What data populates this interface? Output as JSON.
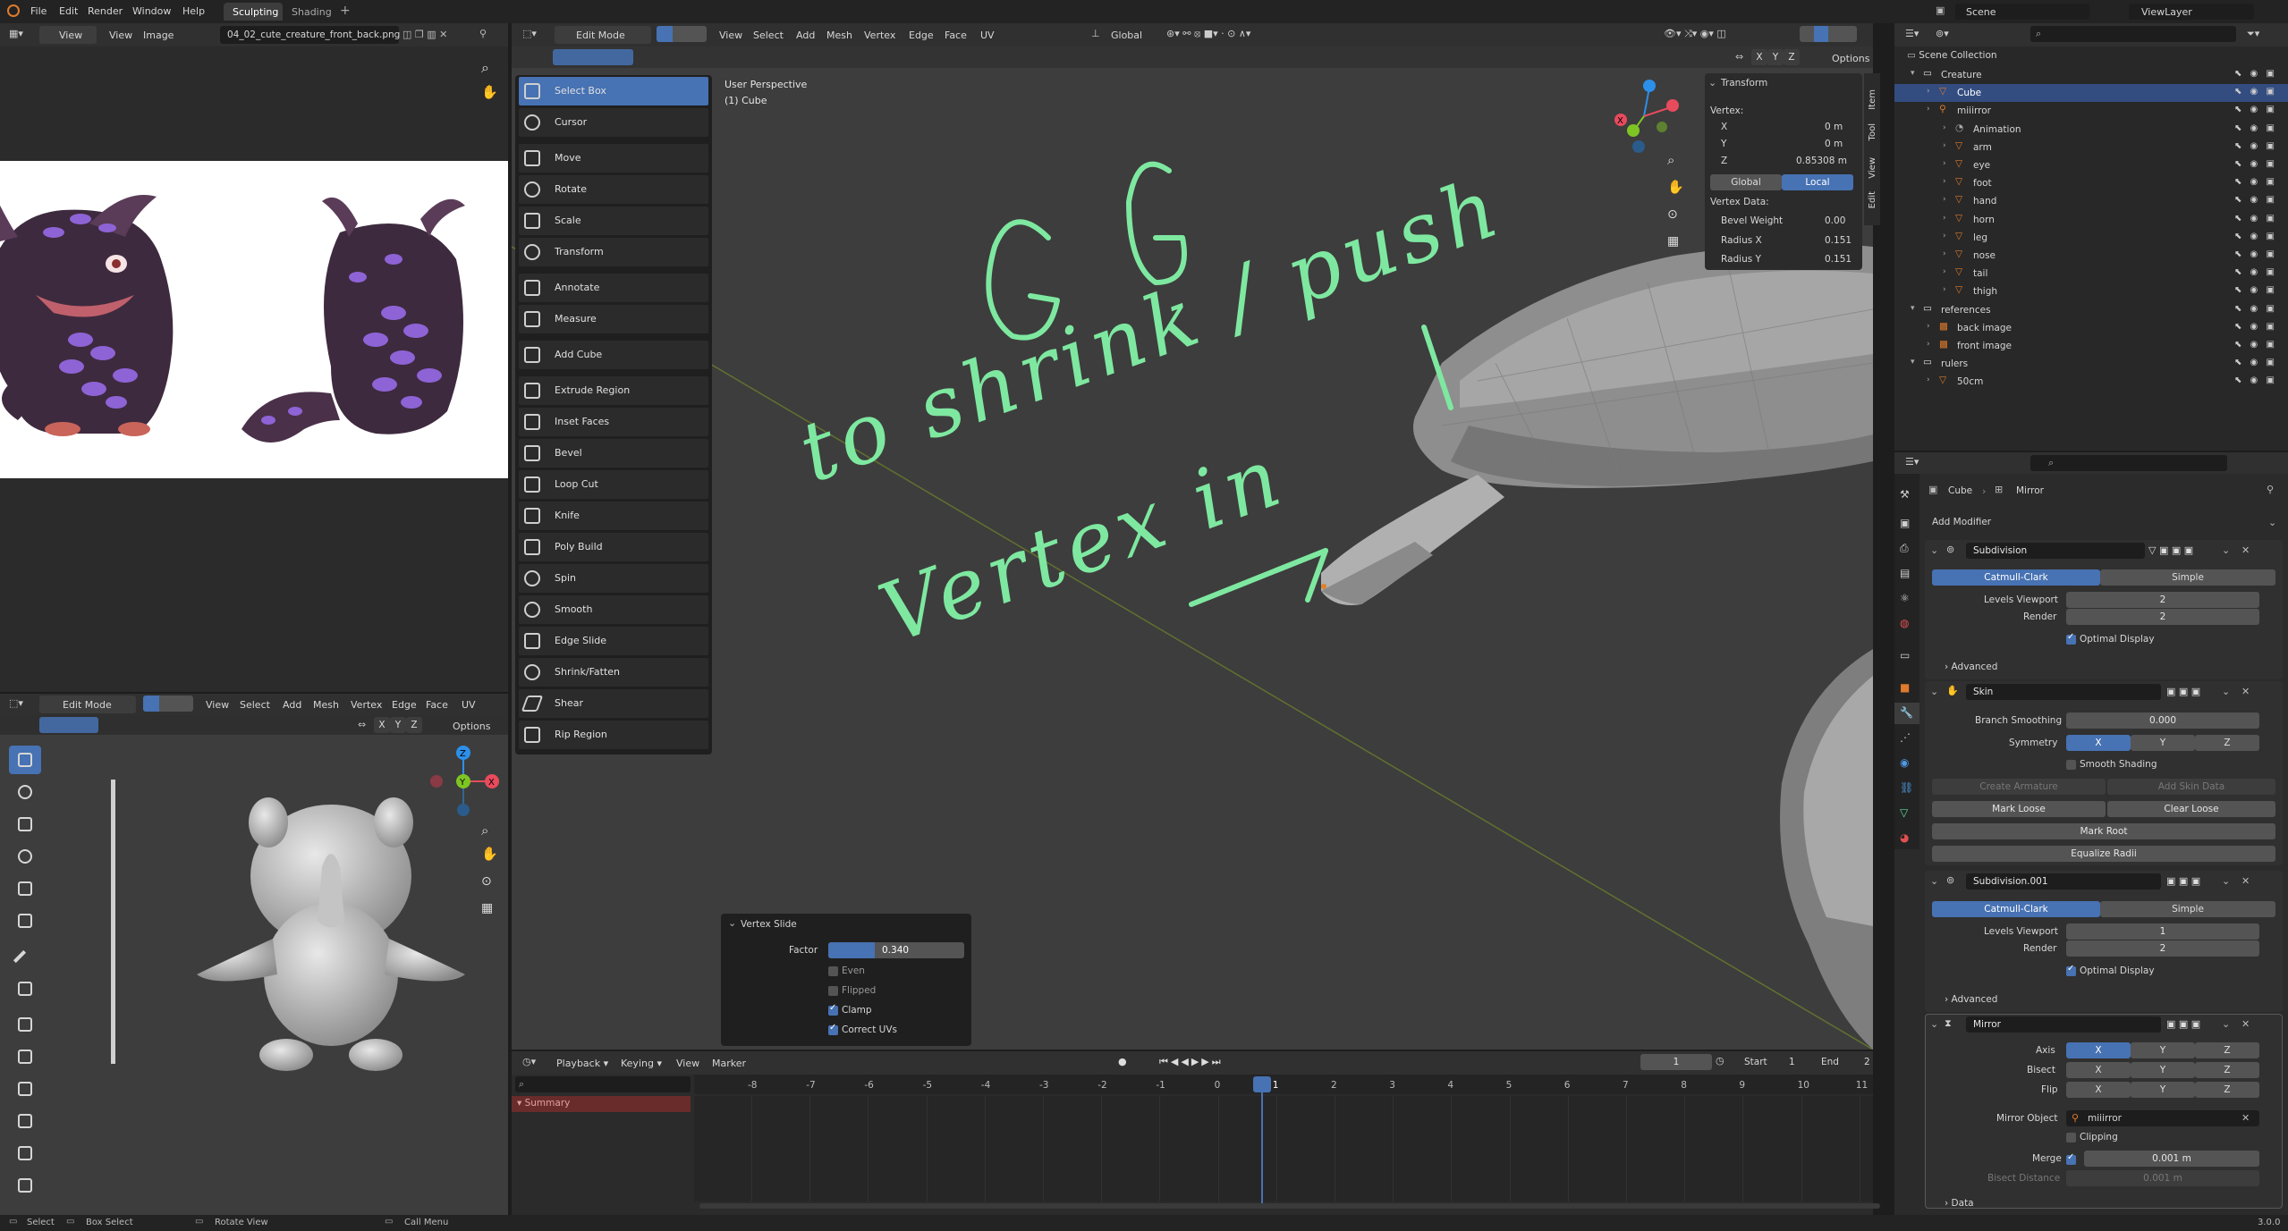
{
  "menubar": {
    "items": [
      "File",
      "Edit",
      "Render",
      "Window",
      "Help"
    ],
    "workspaces": [
      "Sculpting",
      "Shading"
    ],
    "add_tab": "+",
    "scene": "Scene",
    "view_layer": "ViewLayer"
  },
  "image_editor": {
    "view": "View",
    "menu": [
      "View",
      "Image"
    ],
    "filename": "04_02_cute_creature_front_back.png"
  },
  "viewport": {
    "mode": "Edit Mode",
    "menu": [
      "View",
      "Select",
      "Add",
      "Mesh",
      "Vertex",
      "Edge",
      "Face",
      "UV"
    ],
    "orientation": "Global",
    "options": "Options",
    "xyz": [
      "X",
      "Y",
      "Z"
    ],
    "perspective": "User Perspective",
    "object": "(1) Cube",
    "tools": [
      "Select Box",
      "Cursor",
      "Move",
      "Rotate",
      "Scale",
      "Transform",
      "Annotate",
      "Measure",
      "Add Cube",
      "Extrude Region",
      "Inset Faces",
      "Bevel",
      "Loop Cut",
      "Knife",
      "Poly Build",
      "Spin",
      "Smooth",
      "Edge Slide",
      "Shrink/Fatten",
      "Shear",
      "Rip Region"
    ],
    "side_tabs": [
      "Item",
      "Tool",
      "View",
      "Edit"
    ],
    "annotation": {
      "line1": "GG",
      "line2": "to shrink / push",
      "line3": "Vertex in"
    }
  },
  "transform_panel": {
    "title": "Transform",
    "vertex_label": "Vertex:",
    "x_label": "X",
    "x_value": "0 m",
    "y_label": "Y",
    "y_value": "0 m",
    "z_label": "Z",
    "z_value": "0.85308 m",
    "global": "Global",
    "local": "Local",
    "vertex_data": "Vertex Data:",
    "bevel_weight_label": "Bevel Weight",
    "bevel_weight": "0.00",
    "radius_x_label": "Radius X",
    "radius_x": "0.151",
    "radius_y_label": "Radius Y",
    "radius_y": "0.151"
  },
  "vertex_slide": {
    "title": "Vertex Slide",
    "factor_label": "Factor",
    "factor": "0.340",
    "factor_fraction": 0.34,
    "even": "Even",
    "flipped": "Flipped",
    "clamp": "Clamp",
    "correct_uvs": "Correct UVs"
  },
  "small_viewport": {
    "mode": "Edit Mode",
    "menu": [
      "View",
      "Select",
      "Add",
      "Mesh",
      "Vertex",
      "Edge",
      "Face",
      "UV"
    ],
    "options": "Options",
    "xyz": [
      "X",
      "Y",
      "Z"
    ]
  },
  "timeline": {
    "menu": [
      "Playback",
      "Keying",
      "View",
      "Marker"
    ],
    "current_frame": "1",
    "start_label": "Start",
    "start": "1",
    "end_label": "End",
    "end": "2",
    "summary": "Summary",
    "ticks": [
      "-8",
      "-7",
      "-6",
      "-5",
      "-4",
      "-3",
      "-2",
      "-1",
      "0",
      "1",
      "2",
      "3",
      "4",
      "5",
      "6",
      "7",
      "8",
      "9",
      "10",
      "11"
    ]
  },
  "outliner": {
    "scene_collection": "Scene Collection",
    "items": [
      {
        "name": "Creature",
        "depth": 1,
        "kind": "collection"
      },
      {
        "name": "Cube",
        "depth": 2,
        "kind": "mesh",
        "selected": true
      },
      {
        "name": "miiirror",
        "depth": 2,
        "kind": "armature"
      },
      {
        "name": "Animation",
        "depth": 3,
        "kind": "anim"
      },
      {
        "name": "arm",
        "depth": 3,
        "kind": "mesh"
      },
      {
        "name": "eye",
        "depth": 3,
        "kind": "mesh"
      },
      {
        "name": "foot",
        "depth": 3,
        "kind": "mesh"
      },
      {
        "name": "hand",
        "depth": 3,
        "kind": "mesh"
      },
      {
        "name": "horn",
        "depth": 3,
        "kind": "mesh"
      },
      {
        "name": "leg",
        "depth": 3,
        "kind": "mesh"
      },
      {
        "name": "nose",
        "depth": 3,
        "kind": "mesh"
      },
      {
        "name": "tail",
        "depth": 3,
        "kind": "mesh"
      },
      {
        "name": "thigh",
        "depth": 3,
        "kind": "mesh"
      },
      {
        "name": "references",
        "depth": 1,
        "kind": "collection"
      },
      {
        "name": "back image",
        "depth": 2,
        "kind": "image"
      },
      {
        "name": "front image",
        "depth": 2,
        "kind": "image"
      },
      {
        "name": "rulers",
        "depth": 1,
        "kind": "collection"
      },
      {
        "name": "50cm",
        "depth": 2,
        "kind": "mesh"
      }
    ]
  },
  "properties": {
    "object": "Cube",
    "modifier_name": "Mirror",
    "add_modifier": "Add Modifier",
    "subdivision": {
      "name": "Subdivision",
      "catmull": "Catmull-Clark",
      "simple": "Simple",
      "levels_label": "Levels Viewport",
      "levels": "2",
      "render_label": "Render",
      "render": "2",
      "optimal": "Optimal Display",
      "advanced": "Advanced"
    },
    "skin": {
      "name": "Skin",
      "branch_label": "Branch Smoothing",
      "branch": "0.000",
      "symmetry_label": "Symmetry",
      "x": "X",
      "y": "Y",
      "z": "Z",
      "smooth_shading": "Smooth Shading",
      "create_armature": "Create Armature",
      "add_skin_data": "Add Skin Data",
      "mark_loose": "Mark Loose",
      "clear_loose": "Clear Loose",
      "mark_root": "Mark Root",
      "equalize": "Equalize Radii"
    },
    "subdivision2": {
      "name": "Subdivision.001",
      "catmull": "Catmull-Clark",
      "simple": "Simple",
      "levels_label": "Levels Viewport",
      "levels": "1",
      "render_label": "Render",
      "render": "2",
      "optimal": "Optimal Display",
      "advanced": "Advanced"
    },
    "mirror": {
      "name": "Mirror",
      "axis_label": "Axis",
      "bisect_label": "Bisect",
      "flip_label": "Flip",
      "x": "X",
      "y": "Y",
      "z": "Z",
      "mirror_object_label": "Mirror Object",
      "mirror_object": "miiirror",
      "clipping": "Clipping",
      "merge_label": "Merge",
      "merge": "0.001 m",
      "bisect_distance_label": "Bisect Distance",
      "bisect_distance": "0.001 m",
      "data": "Data"
    }
  },
  "statusbar": {
    "select": "Select",
    "box_select": "Box Select",
    "rotate_view": "Rotate View",
    "call_menu": "Call Menu",
    "version": "3.0.0"
  },
  "colors": {
    "accent": "#4772b3",
    "annotation": "#7ee8a0",
    "background": "#1d1d1d",
    "viewport": "#3d3d3d"
  }
}
